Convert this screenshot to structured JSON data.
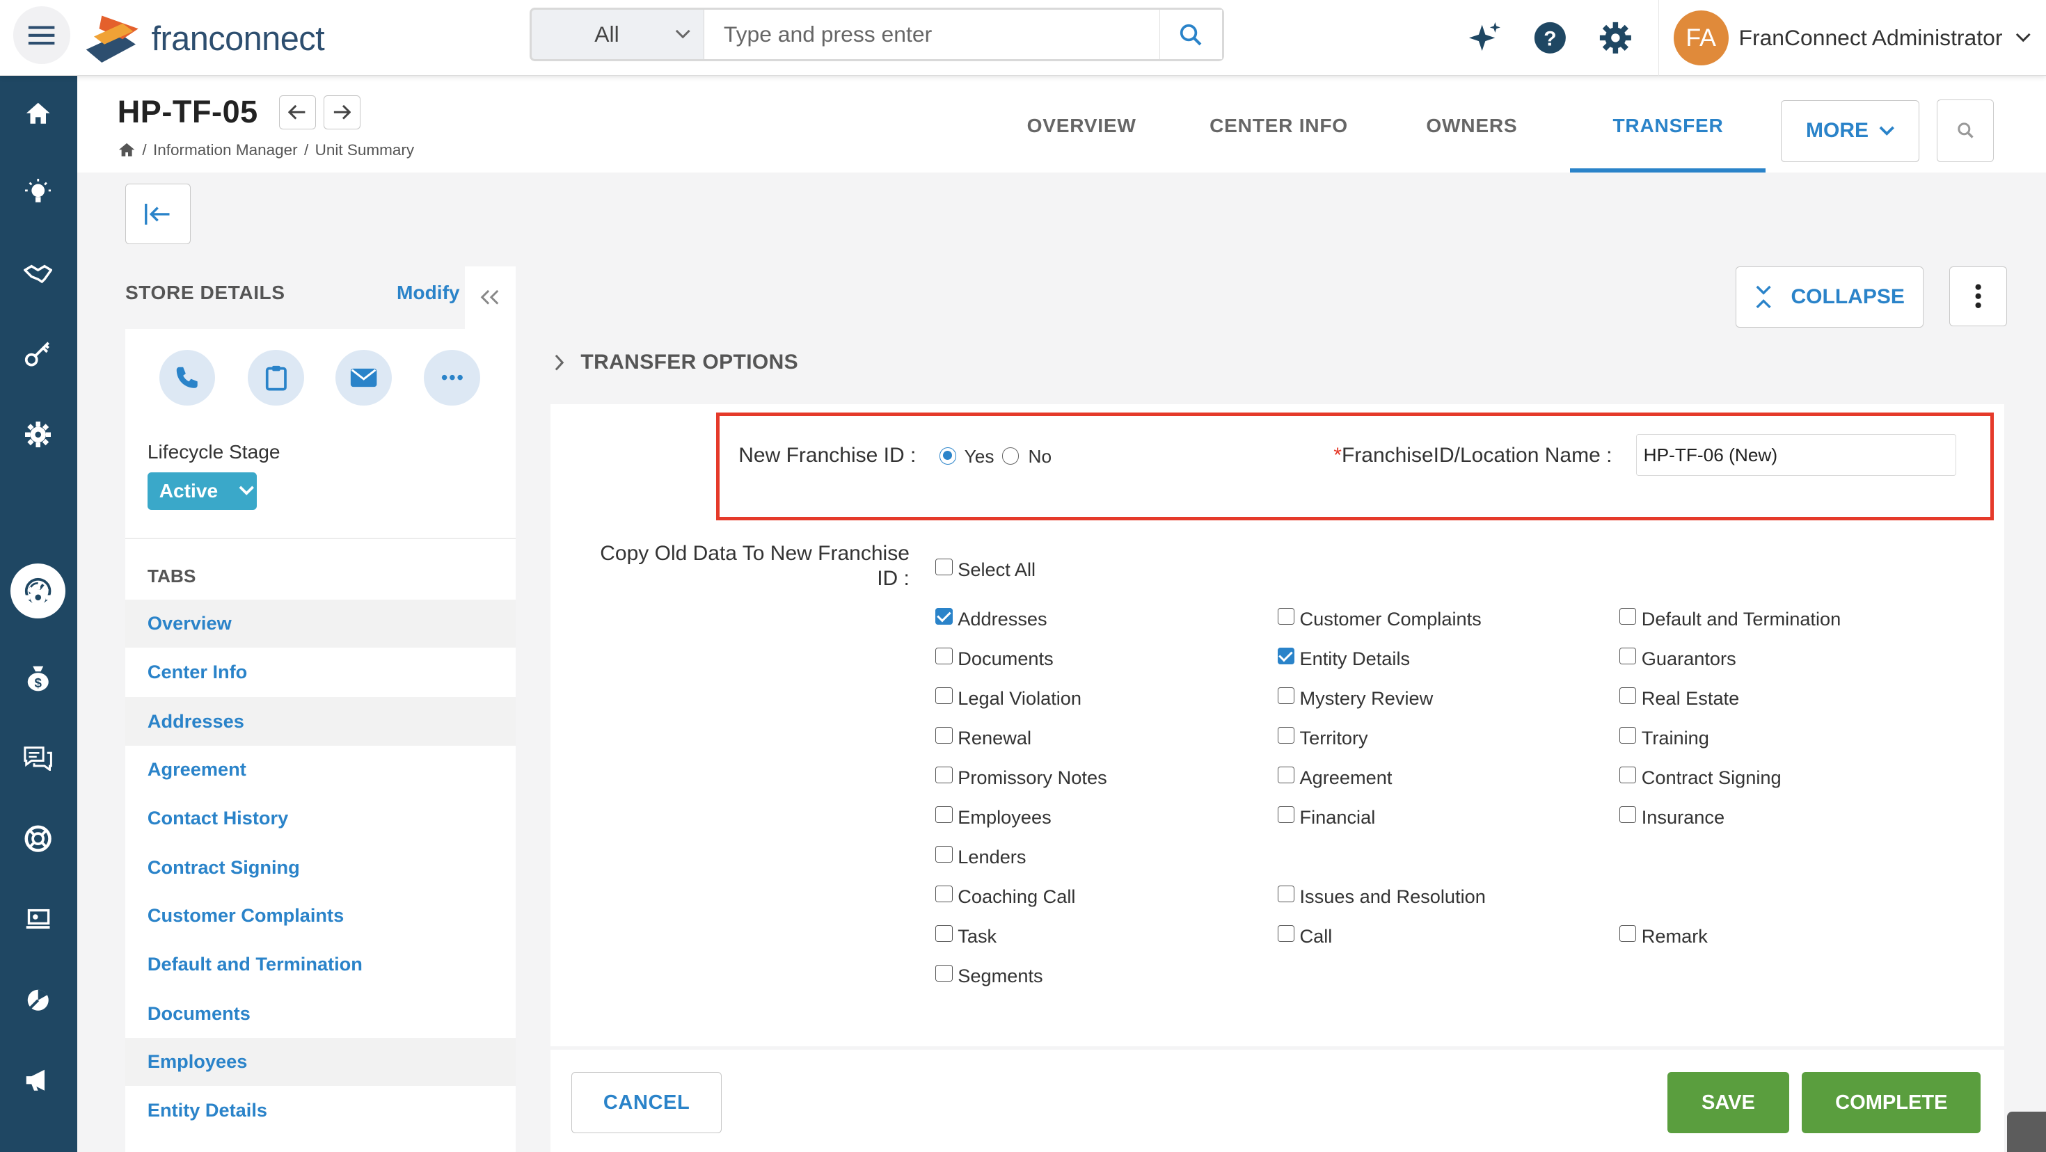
{
  "app": {
    "logo_text": "franconnect"
  },
  "search": {
    "scope": "All",
    "placeholder": "Type and press enter"
  },
  "user": {
    "initials": "FA",
    "name": "FranConnect Administrator"
  },
  "unit": {
    "id": "HP-TF-05"
  },
  "breadcrumb": {
    "items": [
      "Information Manager",
      "Unit Summary"
    ]
  },
  "tabs": [
    {
      "label": "OVERVIEW"
    },
    {
      "label": "CENTER INFO"
    },
    {
      "label": "OWNERS"
    },
    {
      "label": "TRANSFER",
      "active": true
    }
  ],
  "more_label": "MORE",
  "store": {
    "header": "STORE DETAILS",
    "modify": "Modify",
    "lifecycle_label": "Lifecycle Stage",
    "lifecycle_value": "Active"
  },
  "left_tabs": {
    "header": "TABS",
    "items": [
      "Overview",
      "Center Info",
      "Addresses",
      "Agreement",
      "Contact History",
      "Contract Signing",
      "Customer Complaints",
      "Default and Termination",
      "Documents",
      "Employees",
      "Entity Details"
    ]
  },
  "collapse_label": "COLLAPSE",
  "transfer": {
    "section_title": "TRANSFER OPTIONS",
    "new_franchise_label": "New Franchise ID :",
    "yes_label": "Yes",
    "no_label": "No",
    "new_franchise_value": "Yes",
    "location_label": "FranchiseID/Location Name :",
    "location_required_mark": "*",
    "location_value": "HP-TF-06 (New)",
    "copy_label": "Copy Old Data To New Franchise ID :",
    "select_all": "Select All",
    "options": [
      {
        "label": "Addresses",
        "checked": true
      },
      {
        "label": "Customer Complaints",
        "checked": false
      },
      {
        "label": "Default and Termination",
        "checked": false
      },
      {
        "label": "Documents",
        "checked": false
      },
      {
        "label": "Entity Details",
        "checked": true
      },
      {
        "label": "Guarantors",
        "checked": false
      },
      {
        "label": "Legal Violation",
        "checked": false
      },
      {
        "label": "Mystery Review",
        "checked": false
      },
      {
        "label": "Real Estate",
        "checked": false
      },
      {
        "label": "Renewal",
        "checked": false
      },
      {
        "label": "Territory",
        "checked": false
      },
      {
        "label": "Training",
        "checked": false
      },
      {
        "label": "Promissory Notes",
        "checked": false
      },
      {
        "label": "Agreement",
        "checked": false
      },
      {
        "label": "Contract Signing",
        "checked": false
      },
      {
        "label": "Employees",
        "checked": false
      },
      {
        "label": "Financial",
        "checked": false
      },
      {
        "label": "Insurance",
        "checked": false
      },
      {
        "label": "Lenders",
        "checked": false
      },
      {
        "label": "Coaching Call",
        "checked": false
      },
      {
        "label": "Issues and Resolution",
        "checked": false
      },
      {
        "label": "Task",
        "checked": false
      },
      {
        "label": "Call",
        "checked": false
      },
      {
        "label": "Remark",
        "checked": false
      },
      {
        "label": "Segments",
        "checked": false
      }
    ]
  },
  "actions": {
    "cancel": "CANCEL",
    "save": "SAVE",
    "complete": "COMPLETE"
  },
  "colors": {
    "primary": "#2a83c9",
    "sidebar": "#1f4763",
    "success": "#5a9e3e",
    "highlight": "#e53a2a",
    "avatar": "#e08a3a"
  },
  "sidebar_icons": [
    "home-icon",
    "lightbulb-icon",
    "handshake-icon",
    "key-icon",
    "gear-icon",
    "dashboard-icon",
    "gear-icon",
    "money-bag-icon",
    "chat-icon",
    "lifebuoy-icon",
    "laptop-icon",
    "pie-icon",
    "megaphone-icon"
  ]
}
